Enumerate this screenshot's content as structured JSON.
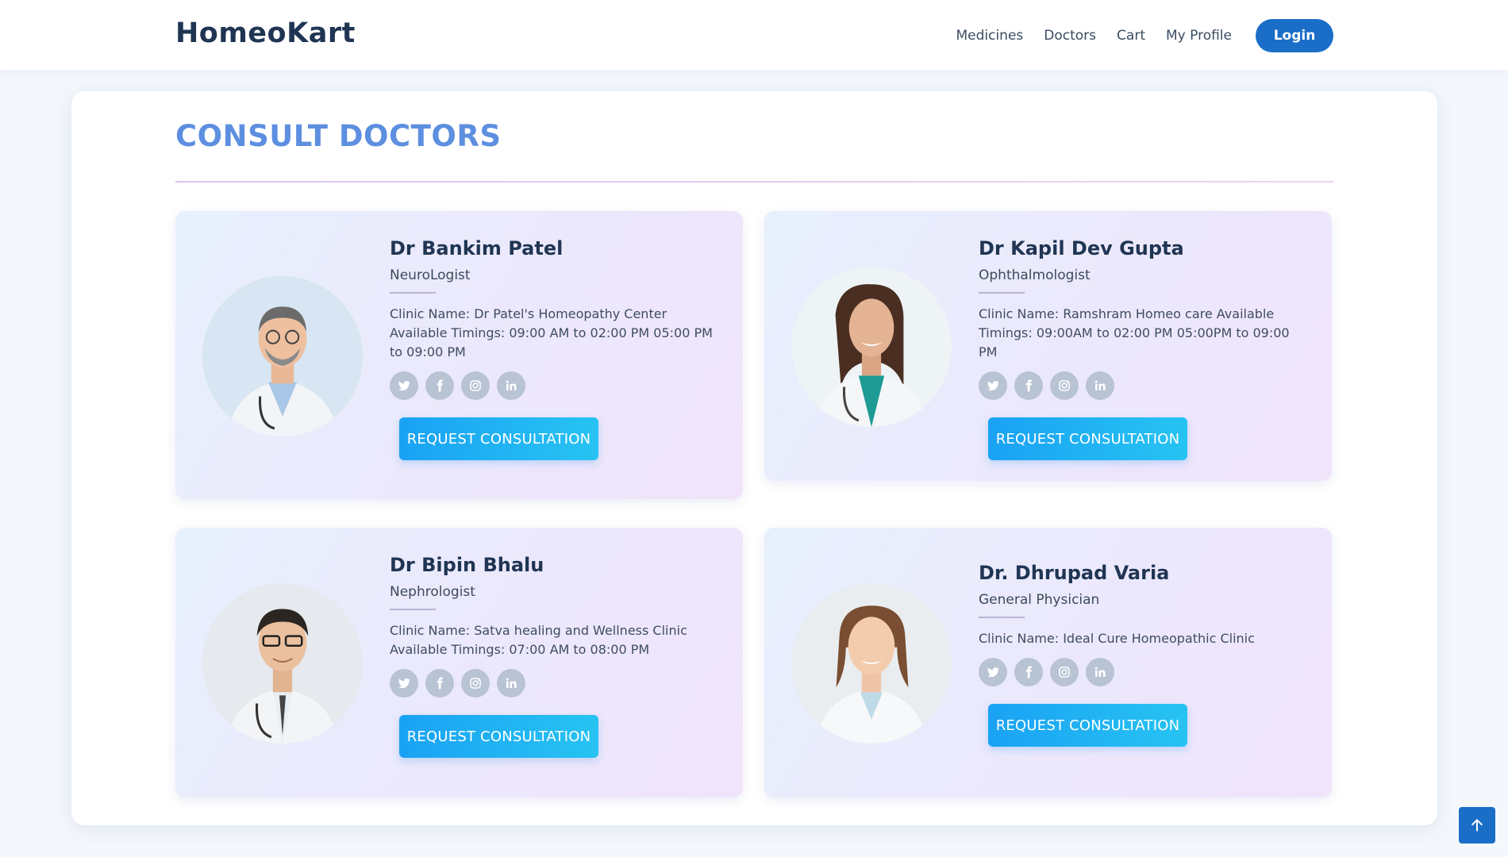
{
  "header": {
    "brand": "HomeoKart",
    "nav": [
      "Medicines",
      "Doctors",
      "Cart",
      "My Profile"
    ],
    "login_label": "Login"
  },
  "page": {
    "title": "CONSULT DOCTORS"
  },
  "doctors": [
    {
      "name": "Dr Bankim Patel",
      "specialty": "NeuroLogist",
      "details": "Clinic Name: Dr Patel's Homeopathy Center Available Timings: 09:00 AM to 02:00 PM 05:00 PM to 09:00 PM",
      "button_label": "REQUEST CONSULTATION"
    },
    {
      "name": "Dr Kapil Dev Gupta",
      "specialty": "Ophthalmologist",
      "details": "Clinic Name: Ramshram Homeo care Available Timings: 09:00AM to 02:00 PM 05:00PM to 09:00 PM",
      "button_label": "REQUEST CONSULTATION"
    },
    {
      "name": "Dr Bipin Bhalu",
      "specialty": "Nephrologist",
      "details": "Clinic Name: Satva healing and Wellness Clinic Available Timings: 07:00 AM to 08:00 PM",
      "button_label": "REQUEST CONSULTATION"
    },
    {
      "name": "Dr. Dhrupad Varia",
      "specialty": "General Physician",
      "details": "Clinic Name: Ideal Cure Homeopathic Clinic",
      "button_label": "REQUEST CONSULTATION"
    }
  ],
  "social_icons": [
    "twitter-icon",
    "facebook-icon",
    "instagram-icon",
    "linkedin-icon"
  ],
  "colors": {
    "brand": "#1f3553",
    "title": "#5d8fe0",
    "login_button": "#1a6ec8",
    "request_button": "#1aa2f4"
  }
}
